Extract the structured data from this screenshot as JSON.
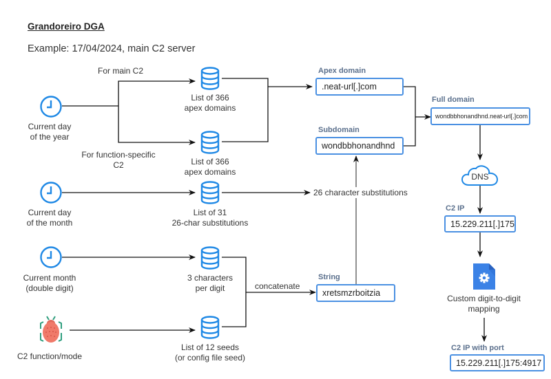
{
  "header": {
    "title": "Grandoreiro DGA ",
    "subtitle": "Example: 17/04/2024, main C2 server"
  },
  "inputs": {
    "day_of_year": {
      "icon": "clock-icon",
      "label_line1": "Current day",
      "label_line2": "of the year"
    },
    "day_of_month": {
      "icon": "clock-icon",
      "label_line1": "Current day",
      "label_line2": "of the month"
    },
    "month": {
      "icon": "clock-icon",
      "label_line1": "Current month",
      "label_line2": "(double digit)"
    },
    "c2_mode": {
      "icon": "bug-icon",
      "label": "C2 function/mode"
    }
  },
  "databases": {
    "apex_main": {
      "icon": "database-icon",
      "label_line1": "List of 366",
      "label_line2": "apex domains"
    },
    "apex_function": {
      "icon": "database-icon",
      "label_line1": "List of 366",
      "label_line2": "apex domains"
    },
    "substitutions": {
      "icon": "database-icon",
      "label_line1": "List of 31",
      "label_line2": "26-char substitutions"
    },
    "chars_per_digit": {
      "icon": "database-icon",
      "label_line1": "3 characters",
      "label_line2": "per digit"
    },
    "seeds": {
      "icon": "database-icon",
      "label_line1": "List of 12 seeds",
      "label_line2": "(or config file seed)"
    }
  },
  "edge_labels": {
    "for_main_c2": "For main C2",
    "for_function_line1": "For function-specific",
    "for_function_line2": "C2",
    "char_substitutions": "26 character substitutions",
    "concatenate": "concatenate"
  },
  "results": {
    "apex_domain": {
      "title": "Apex domain",
      "value": ".neat-url[.]com"
    },
    "subdomain": {
      "title": "Subdomain",
      "value": "wondbbhonandhnd"
    },
    "string": {
      "title": "String",
      "value": "xretsmzrboitzia"
    },
    "full_domain": {
      "title": "Full domain",
      "value": "wondbbhonandhnd.neat-url[.]com"
    },
    "dns": {
      "icon": "cloud-icon",
      "label": "DNS"
    },
    "c2_ip": {
      "title": "C2 IP",
      "value": "15.229.211[.]175"
    },
    "mapping": {
      "icon": "settings-file-icon",
      "label_line1": "Custom digit-to-digit",
      "label_line2": "mapping"
    },
    "c2_ip_port": {
      "title": "C2 IP with port",
      "value": "15.229.211[.]175:4917"
    }
  },
  "colors": {
    "accent_blue": "#1e88e5",
    "box_border": "#4a90e2",
    "box_title": "#5a6f8c",
    "bug_body": "#f07a6a",
    "bug_legs": "#2e9e7e",
    "file_blue": "#3b82e6"
  }
}
